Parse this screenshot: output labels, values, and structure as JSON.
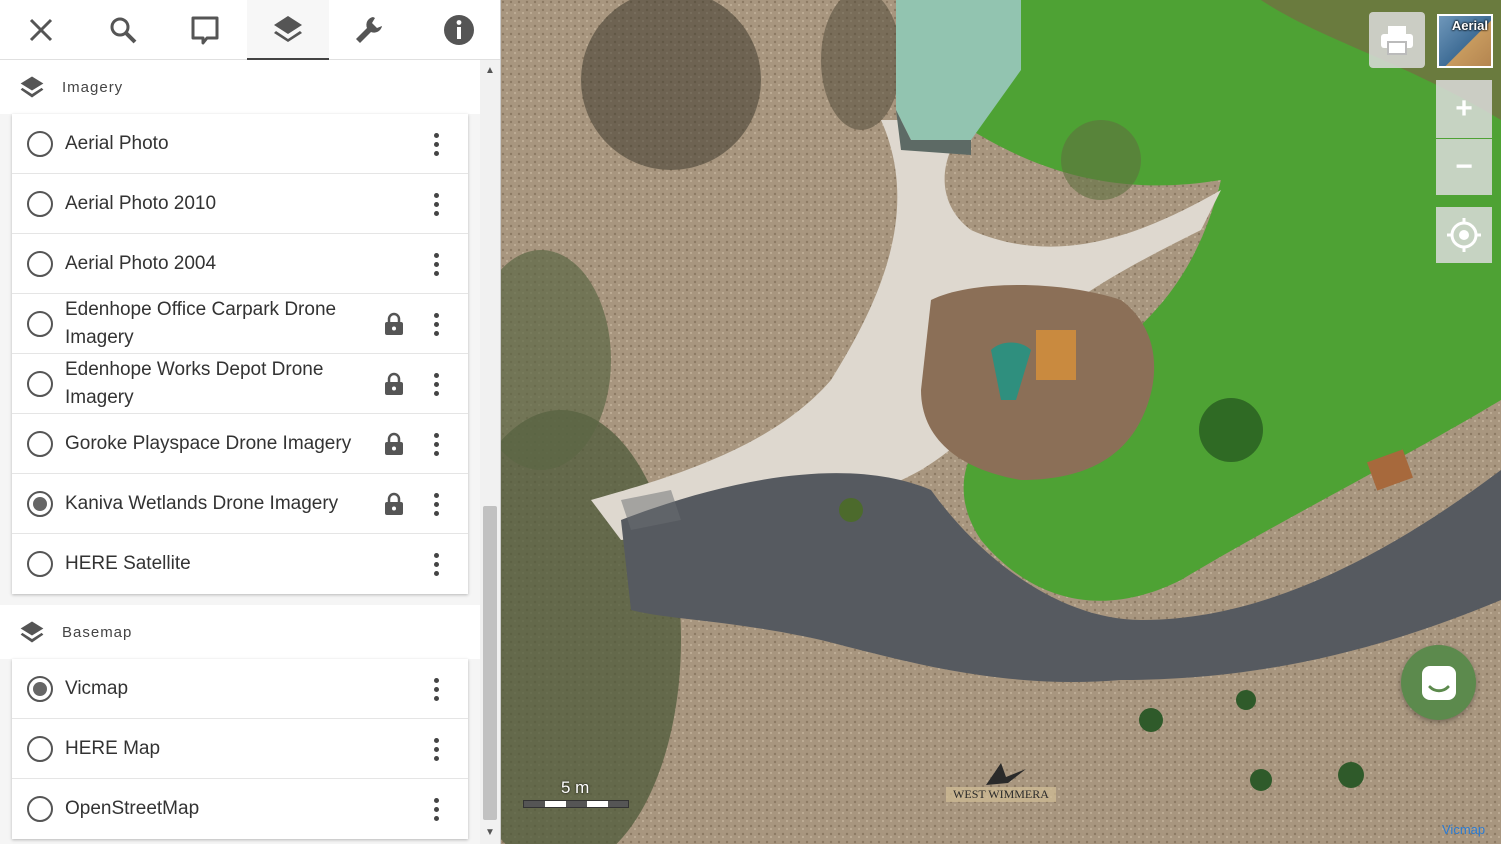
{
  "toolbar": {
    "tools": [
      {
        "name": "close-icon"
      },
      {
        "name": "search-icon"
      },
      {
        "name": "comment-icon"
      },
      {
        "name": "layers-icon",
        "active": true
      },
      {
        "name": "wrench-icon"
      },
      {
        "name": "info-icon"
      }
    ]
  },
  "imagery": {
    "title": "Imagery",
    "items": [
      {
        "label": "Aerial Photo",
        "checked": false,
        "locked": false
      },
      {
        "label": "Aerial Photo 2010",
        "checked": false,
        "locked": false
      },
      {
        "label": "Aerial Photo 2004",
        "checked": false,
        "locked": false
      },
      {
        "label": "Edenhope Office Carpark Drone Imagery",
        "checked": false,
        "locked": true
      },
      {
        "label": "Edenhope Works Depot Drone Imagery",
        "checked": false,
        "locked": true
      },
      {
        "label": "Goroke Playspace Drone Imagery",
        "checked": false,
        "locked": true
      },
      {
        "label": "Kaniva Wetlands Drone Imagery",
        "checked": true,
        "locked": true
      },
      {
        "label": "HERE Satellite",
        "checked": false,
        "locked": false
      }
    ]
  },
  "basemap": {
    "title": "Basemap",
    "items": [
      {
        "label": "Vicmap",
        "checked": true
      },
      {
        "label": "HERE Map",
        "checked": false
      },
      {
        "label": "OpenStreetMap",
        "checked": false
      }
    ]
  },
  "map": {
    "basemap_thumb_label": "Aerial",
    "zoom_in": "+",
    "zoom_out": "−",
    "scale_label": "5 m",
    "logo_text": "WEST WIMMERA",
    "attribution": "Vicmap"
  },
  "colors": {
    "chat_button": "#5c8a4d",
    "attribution_link": "#2a7bd4"
  }
}
